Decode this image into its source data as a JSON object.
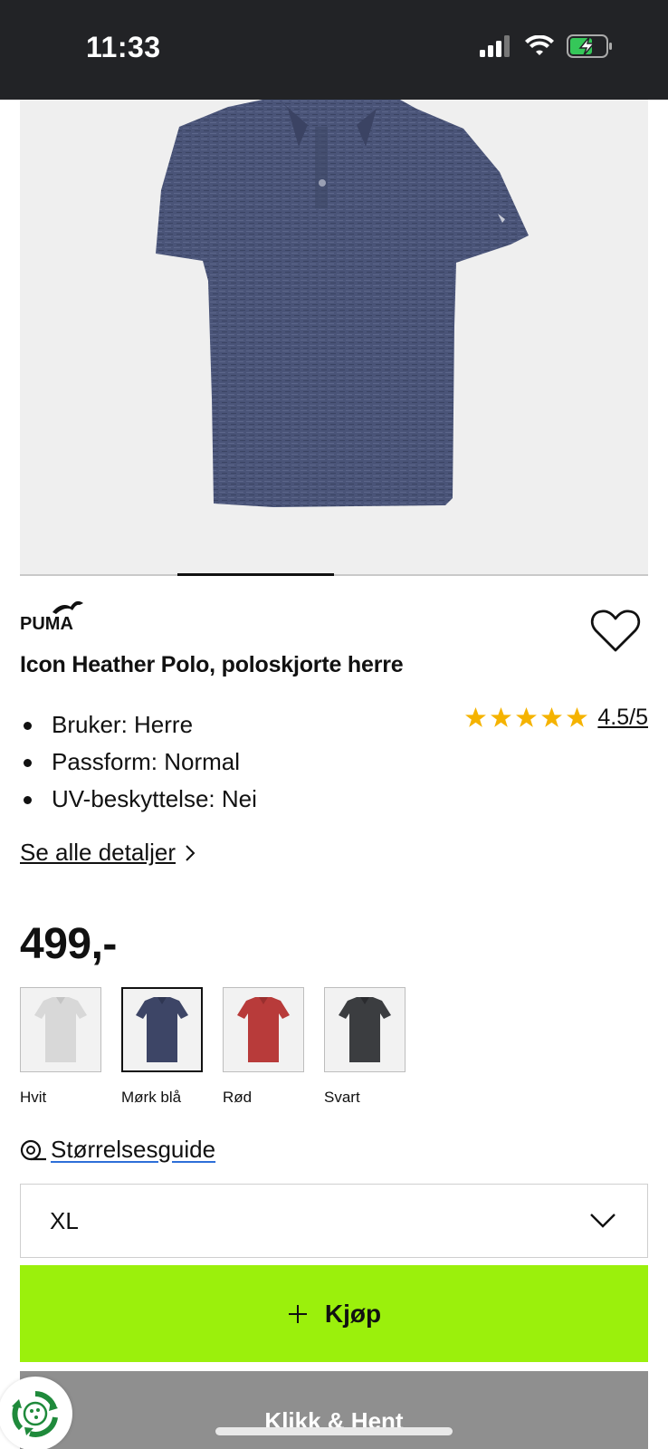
{
  "status_bar": {
    "time": "11:33",
    "icons": [
      "signal-icon",
      "wifi-icon",
      "battery-charging-icon"
    ]
  },
  "product": {
    "brand": "PUMA",
    "title": "Icon Heather Polo, poloskjorte herre",
    "image_icon": "polo-shirt-image",
    "carousel": {
      "current": 2,
      "total": 4
    },
    "favorite_icon": "heart-outline-icon",
    "bullets": [
      "Bruker: Herre",
      "Passform: Normal",
      "UV-beskyttelse: Nei"
    ],
    "rating": {
      "value": 4.5,
      "max": 5,
      "label": "4.5/5",
      "star_color": "#f5b300"
    },
    "details_link": "Se alle detaljer",
    "price": "499,-"
  },
  "swatches": [
    {
      "label": "Hvit",
      "color": "#d8d8d8",
      "selected": false
    },
    {
      "label": "Mørk blå",
      "color": "#3d4566",
      "selected": true
    },
    {
      "label": "Rød",
      "color": "#b83b3a",
      "selected": false
    },
    {
      "label": "Svart",
      "color": "#3b3d40",
      "selected": false
    }
  ],
  "size_guide": {
    "label": "Størrelsesguide",
    "icon": "tape-measure-icon"
  },
  "size_select": {
    "value": "XL",
    "icon": "chevron-down-icon"
  },
  "buttons": {
    "buy": "Kjøp",
    "buy_icon": "plus-icon",
    "buy_color": "#9bf00c",
    "pickup": "Klikk & Hent"
  },
  "floating_badge_icon": "recycle-icon"
}
